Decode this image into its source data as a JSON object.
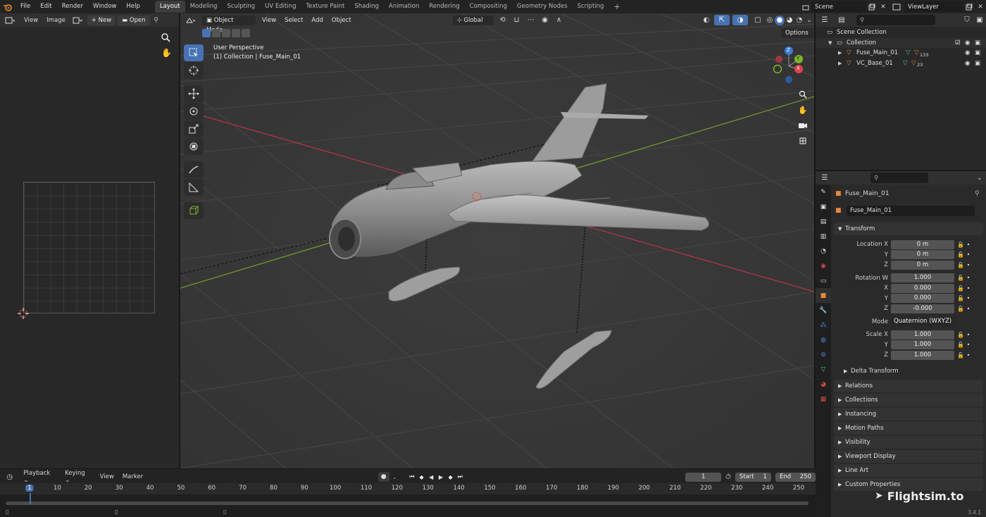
{
  "topbar": {
    "menus": [
      "File",
      "Edit",
      "Render",
      "Window",
      "Help"
    ],
    "workspaces": [
      "Layout",
      "Modeling",
      "Sculpting",
      "UV Editing",
      "Texture Paint",
      "Shading",
      "Animation",
      "Rendering",
      "Compositing",
      "Geometry Nodes",
      "Scripting"
    ],
    "active_workspace": "Layout",
    "add_tab": "+",
    "scene": "Scene",
    "view_layer": "ViewLayer"
  },
  "image_editor": {
    "menus": [
      "View",
      "Image"
    ],
    "new_label": "New",
    "open_label": "Open"
  },
  "viewport": {
    "mode": "Object Mode",
    "menus": [
      "View",
      "Select",
      "Add",
      "Object"
    ],
    "orientation": "Global",
    "options_label": "Options",
    "perspective_label": "User Perspective",
    "collection_label": "(1) Collection | Fuse_Main_01",
    "gizmo_axes": [
      "X",
      "Y",
      "Z"
    ]
  },
  "outliner": {
    "scene_collection": "Scene Collection",
    "collection": "Collection",
    "objects": [
      {
        "name": "Fuse_Main_01",
        "count": "133"
      },
      {
        "name": "VC_Base_01",
        "count": "23"
      }
    ]
  },
  "properties": {
    "object_name": "Fuse_Main_01",
    "datablock_name": "Fuse_Main_01",
    "transform_label": "Transform",
    "location": {
      "label": "Location",
      "x": "0 m",
      "y": "0 m",
      "z": "0 m"
    },
    "rotation": {
      "label": "Rotation",
      "w": "1.000",
      "x": "0.000",
      "y": "0.000",
      "z": "-0.000"
    },
    "mode_label": "Mode",
    "mode_value": "Quaternion (WXYZ)",
    "scale": {
      "label": "Scale",
      "x": "1.000",
      "y": "1.000",
      "z": "1.000"
    },
    "axis_letters": {
      "x": "X",
      "y": "Y",
      "z": "Z",
      "w": "W"
    },
    "delta_transform": "Delta Transform",
    "panels": [
      "Relations",
      "Collections",
      "Instancing",
      "Motion Paths",
      "Visibility",
      "Viewport Display",
      "Line Art",
      "Custom Properties"
    ]
  },
  "timeline": {
    "menus": [
      "Playback",
      "Keying",
      "View",
      "Marker"
    ],
    "current_frame": "1",
    "start_label": "Start",
    "start": "1",
    "end_label": "End",
    "end": "250",
    "ticks": [
      "1",
      "10",
      "20",
      "30",
      "40",
      "50",
      "60",
      "70",
      "80",
      "90",
      "100",
      "110",
      "120",
      "130",
      "140",
      "150",
      "160",
      "170",
      "180",
      "190",
      "200",
      "210",
      "220",
      "230",
      "240",
      "250"
    ]
  },
  "watermark": "Flightsim.to",
  "version": "3.4.1",
  "colors": {
    "accent": "#4772b3",
    "x_axis": "#e0414c",
    "y_axis": "#7ab52c",
    "z_axis": "#3b7ed8",
    "object_orange": "#e8883a"
  }
}
